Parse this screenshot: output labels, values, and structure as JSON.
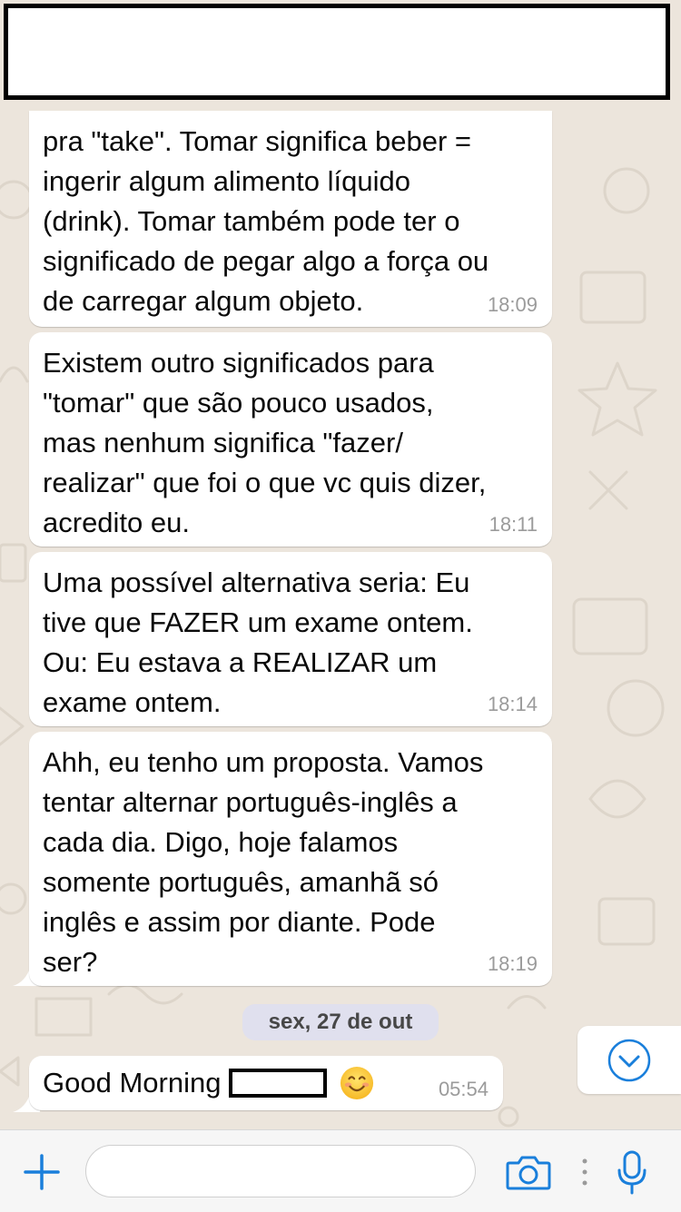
{
  "messages": [
    {
      "text": "pra \"take\". Tomar significa beber =\ningerir algum alimento líquido\n(drink). Tomar também pode ter o\nsignificado de pegar algo a força ou\nde carregar algum objeto.",
      "time": "18:09"
    },
    {
      "text": "Existem outro significados para\n\"tomar\" que são pouco usados,\nmas nenhum significa \"fazer/\nrealizar\" que foi o que vc quis dizer,\nacredito eu.",
      "time": "18:11"
    },
    {
      "text": "Uma possível alternativa seria: Eu\ntive que FAZER um exame ontem.\nOu: Eu estava a REALIZAR um\nexame ontem.",
      "time": "18:14"
    },
    {
      "text": "Ahh, eu tenho um proposta. Vamos\ntentar alternar português-inglês a\ncada dia. Digo, hoje falamos\nsomente português, amanhã só\ninglês e assim por diante. Pode\nser?",
      "time": "18:19"
    }
  ],
  "date_separator": "sex, 27 de out",
  "last_message": {
    "text": "Good Morning",
    "time": "05:54",
    "emoji": "smiling-face-icon"
  },
  "input": {
    "placeholder": "",
    "value": ""
  },
  "icons": {
    "add": "plus-icon",
    "camera": "camera-icon",
    "mic": "microphone-icon",
    "scroll_down": "chevron-down-icon"
  },
  "colors": {
    "accent": "#1a7fdb",
    "background": "#ece5dc",
    "bubble": "#ffffff",
    "timestamp": "#9b9b9b"
  }
}
